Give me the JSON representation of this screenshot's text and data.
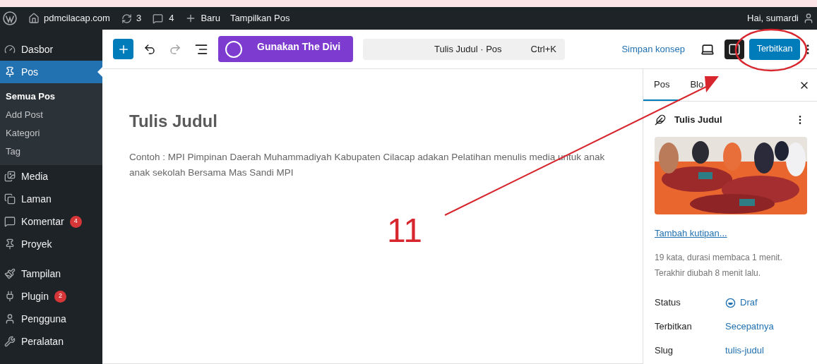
{
  "admin_bar": {
    "site": "pdmcilacap.com",
    "updates": "3",
    "comments": "4",
    "new_label": "Baru",
    "view_label": "Tampilkan Pos",
    "greeting": "Hai, sumardi"
  },
  "sidebar": {
    "items": [
      {
        "label": "Dasbor",
        "selected": false
      },
      {
        "label": "Pos",
        "selected": true,
        "children": [
          {
            "label": "Semua Pos",
            "selected": true
          },
          {
            "label": "Add Post",
            "selected": false
          },
          {
            "label": "Kategori",
            "selected": false
          },
          {
            "label": "Tag",
            "selected": false
          }
        ]
      },
      {
        "label": "Media",
        "selected": false
      },
      {
        "label": "Laman",
        "selected": false
      },
      {
        "label": "Komentar",
        "selected": false,
        "badge": "4"
      },
      {
        "label": "Proyek",
        "selected": false
      },
      {
        "label": "Tampilan",
        "selected": false
      },
      {
        "label": "Plugin",
        "selected": false,
        "badge": "2"
      },
      {
        "label": "Pengguna",
        "selected": false
      },
      {
        "label": "Peralatan",
        "selected": false
      }
    ]
  },
  "toolbar": {
    "divi_button": "Gunakan The Divi",
    "command_title": "Tulis Judul · Pos",
    "shortcut": "Ctrl+K",
    "save_draft": "Simpan konsep",
    "publish": "Terbitkan"
  },
  "document": {
    "title": "Tulis Judul",
    "body": "Contoh : MPI Pimpinan Daerah Muhammadiyah Kabupaten Cilacap adakan Pelatihan menulis media untuk anak anak sekolah Bersama Mas Sandi MPI"
  },
  "settings": {
    "tabs": [
      {
        "label": "Pos",
        "selected": true
      },
      {
        "label": "Blo",
        "selected": false
      }
    ],
    "post_title": "Tulis Judul",
    "excerpt_link": "Tambah kutipan...",
    "stats": [
      "19 kata, durasi membaca 1 menit.",
      "Terakhir diubah 8 menit lalu."
    ],
    "rows": [
      {
        "label": "Status",
        "value": "Draf",
        "kind": "status"
      },
      {
        "label": "Terbitkan",
        "value": "Secepatnya",
        "kind": "link"
      },
      {
        "label": "Slug",
        "value": "tulis-judul",
        "kind": "link"
      }
    ]
  },
  "annotation": {
    "number": "11"
  }
}
